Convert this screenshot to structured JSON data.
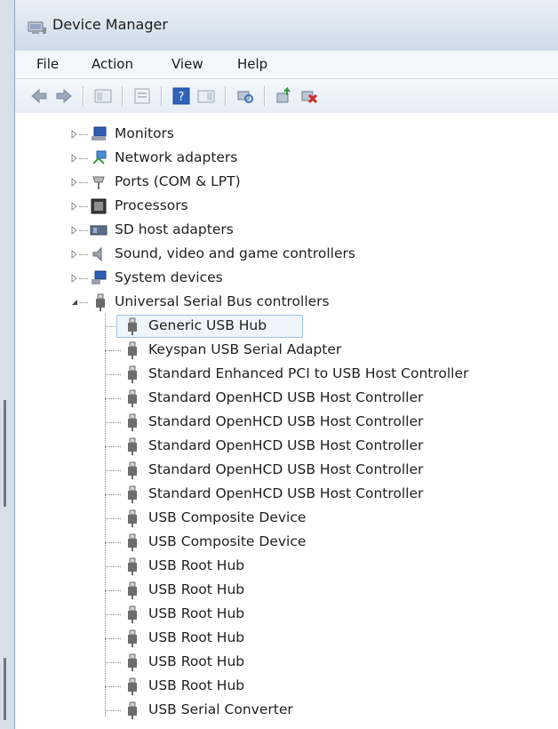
{
  "window": {
    "title": "Device Manager"
  },
  "menu": [
    "File",
    "Action",
    "View",
    "Help"
  ],
  "toolbar": {
    "buttons": [
      "back-icon",
      "forward-icon",
      "show-hide-icon",
      "properties-icon",
      "help-icon",
      "action-pane-icon",
      "scan-hardware-icon",
      "update-driver-icon",
      "uninstall-icon"
    ]
  },
  "tree": {
    "categories": [
      {
        "label": "Monitors",
        "icon": "monitor-icon"
      },
      {
        "label": "Network adapters",
        "icon": "network-adapter-icon"
      },
      {
        "label": "Ports (COM & LPT)",
        "icon": "port-icon"
      },
      {
        "label": "Processors",
        "icon": "processor-icon"
      },
      {
        "label": "SD host adapters",
        "icon": "sd-adapter-icon"
      },
      {
        "label": "Sound, video and game controllers",
        "icon": "speaker-icon"
      },
      {
        "label": "System devices",
        "icon": "system-devices-icon"
      },
      {
        "label": "Universal Serial Bus controllers",
        "icon": "usb-icon"
      }
    ],
    "usb_children": [
      "Generic USB Hub",
      "Keyspan USB Serial Adapter",
      "Standard Enhanced PCI to USB Host Controller",
      "Standard OpenHCD USB Host Controller",
      "Standard OpenHCD USB Host Controller",
      "Standard OpenHCD USB Host Controller",
      "Standard OpenHCD USB Host Controller",
      "Standard OpenHCD USB Host Controller",
      "USB Composite Device",
      "USB Composite Device",
      "USB Root Hub",
      "USB Root Hub",
      "USB Root Hub",
      "USB Root Hub",
      "USB Root Hub",
      "USB Root Hub",
      "USB Serial Converter"
    ],
    "selected": "Generic USB Hub"
  },
  "colors": {
    "selection_border": "#9ec3e6",
    "selection_fill": "#eef5fc"
  }
}
